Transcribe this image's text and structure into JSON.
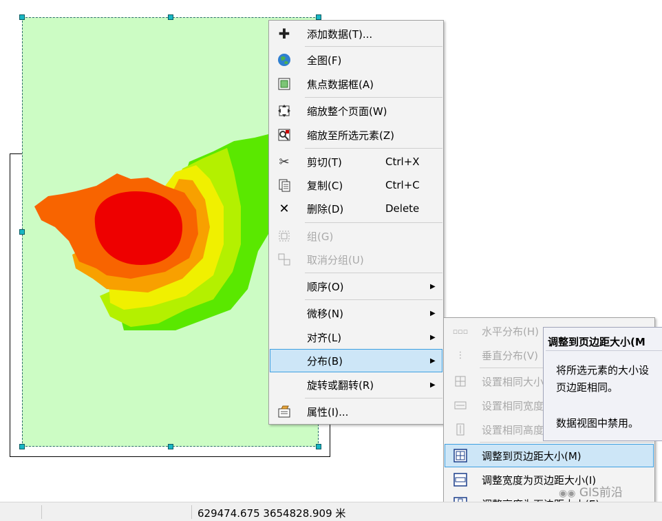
{
  "context_menu": {
    "items": [
      {
        "label": "添加数据(T)...",
        "icon": "add-data-icon",
        "shortcut": "",
        "disabled": false
      },
      {
        "label": "全图(F)",
        "icon": "globe-icon",
        "shortcut": "",
        "disabled": false
      },
      {
        "label": "焦点数据框(A)",
        "icon": "focus-frame-icon",
        "shortcut": "",
        "disabled": false
      },
      {
        "label": "缩放整个页面(W)",
        "icon": "zoom-whole-page-icon",
        "shortcut": "",
        "disabled": false
      },
      {
        "label": "缩放至所选元素(Z)",
        "icon": "zoom-to-selected-icon",
        "shortcut": "",
        "disabled": false
      },
      {
        "label": "剪切(T)",
        "icon": "scissors-icon",
        "shortcut": "Ctrl+X",
        "disabled": false
      },
      {
        "label": "复制(C)",
        "icon": "copy-icon",
        "shortcut": "Ctrl+C",
        "disabled": false
      },
      {
        "label": "删除(D)",
        "icon": "delete-x-icon",
        "shortcut": "Delete",
        "disabled": false
      },
      {
        "label": "组(G)",
        "icon": "group-icon",
        "shortcut": "",
        "disabled": true
      },
      {
        "label": "取消分组(U)",
        "icon": "ungroup-icon",
        "shortcut": "",
        "disabled": true
      },
      {
        "label": "顺序(O)",
        "icon": "",
        "shortcut": "",
        "disabled": false,
        "submenu": true
      },
      {
        "label": "微移(N)",
        "icon": "",
        "shortcut": "",
        "disabled": false,
        "submenu": true
      },
      {
        "label": "对齐(L)",
        "icon": "",
        "shortcut": "",
        "disabled": false,
        "submenu": true
      },
      {
        "label": "分布(B)",
        "icon": "",
        "shortcut": "",
        "disabled": false,
        "submenu": true,
        "highlighted": true
      },
      {
        "label": "旋转或翻转(R)",
        "icon": "",
        "shortcut": "",
        "disabled": false,
        "submenu": true
      },
      {
        "label": "属性(I)...",
        "icon": "properties-icon",
        "shortcut": "",
        "disabled": false
      }
    ]
  },
  "submenu": {
    "items": [
      {
        "label": "水平分布(H)",
        "icon": "distribute-horizontal-icon",
        "disabled": true
      },
      {
        "label": "垂直分布(V)",
        "icon": "distribute-vertical-icon",
        "disabled": true
      },
      {
        "label": "设置相同大小",
        "icon": "same-size-icon",
        "disabled": true
      },
      {
        "label": "设置相同宽度",
        "icon": "same-width-icon",
        "disabled": true
      },
      {
        "label": "设置相同高度",
        "icon": "same-height-icon",
        "disabled": true
      },
      {
        "label": "调整到页边距大小(M)",
        "icon": "fit-to-margins-icon",
        "disabled": false,
        "highlighted": true
      },
      {
        "label": "调整宽度为页边距大小(I)",
        "icon": "fit-width-to-margins-icon",
        "disabled": false
      },
      {
        "label": "调整高度为页边距大小(E)",
        "icon": "fit-height-to-margins-icon",
        "disabled": false
      }
    ]
  },
  "tooltip": {
    "title": "调整到页边距大小(M",
    "body_line1": "将所选元素的大小设",
    "body_line2": "页边距相同。",
    "note": "数据视图中禁用。"
  },
  "statusbar": {
    "coordinates": "629474.675  3654828.909 米"
  },
  "watermark": "GIS前沿",
  "colors": {
    "frame_background": "#ccfcc4",
    "highlight": "#cde6f7",
    "highlight_border": "#3c9fe0",
    "zone_red": "#ee0000",
    "zone_orange": "#f86400",
    "zone_light_orange": "#f8a000",
    "zone_yellow": "#f0f000",
    "zone_yellow_green": "#b4f000",
    "zone_green": "#5ae800"
  }
}
